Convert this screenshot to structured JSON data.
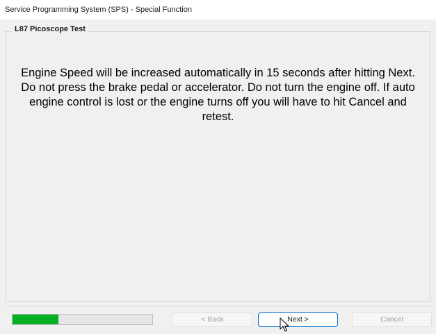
{
  "window": {
    "title": "Service Programming System (SPS) - Special Function"
  },
  "group": {
    "title": "L87 Picoscope Test"
  },
  "message": "Engine Speed will be increased automatically in 15 seconds after hitting Next. Do not press the brake pedal or accelerator. Do not turn the engine off. If auto engine control is lost or the engine turns off you will have to hit Cancel and retest.",
  "progress": {
    "fraction": 0.33,
    "fill_color": "#06b025"
  },
  "buttons": {
    "back": "< Back",
    "next": "Next >",
    "cancel": "Cancel"
  },
  "cursor": {
    "icon": "pointer-cursor-icon"
  }
}
